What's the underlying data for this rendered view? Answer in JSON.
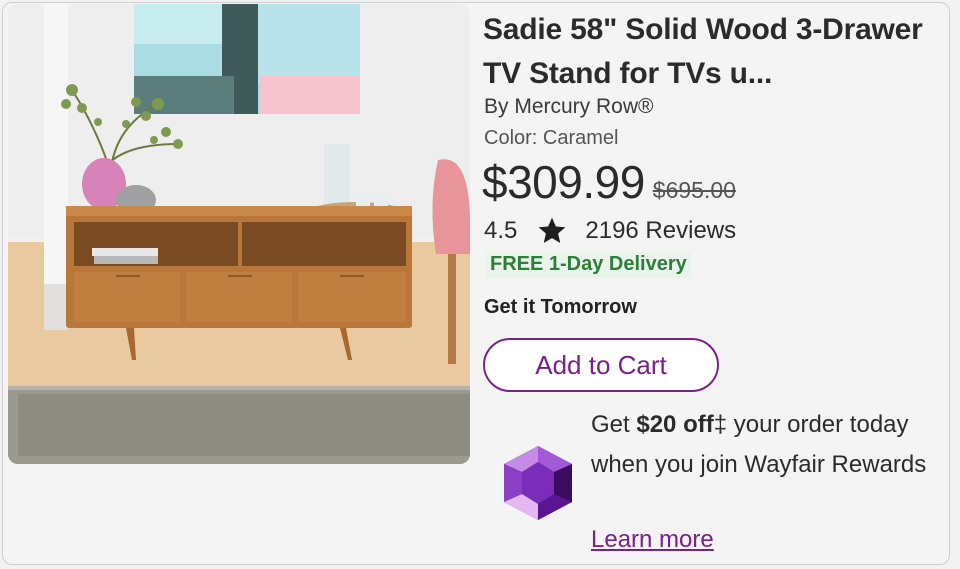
{
  "product": {
    "title": "Sadie 58\" Solid Wood 3-Drawer TV Stand for TVs u...",
    "brand": "By Mercury Row®",
    "color": "Color: Caramel",
    "price": "$309.99",
    "old_price": "$695.00",
    "rating": "4.5",
    "reviews": "2196 Reviews",
    "delivery_badge": "FREE 1-Day Delivery",
    "delivery_eta": "Get it Tomorrow",
    "add_to_cart_label": "Add to Cart"
  },
  "rewards": {
    "prefix": "Get ",
    "amount": "$20 off",
    "dagger": "‡",
    "rest": " your order today when you join Wayfair Rewards",
    "link": "Learn more"
  },
  "colors": {
    "brand_purple": "#7b1f8a",
    "delivery_green": "#2e7d3a",
    "delivery_bg": "#e9f4ea"
  },
  "icons": {
    "rating": "star-icon",
    "rewards": "rewards-gem-icon"
  }
}
